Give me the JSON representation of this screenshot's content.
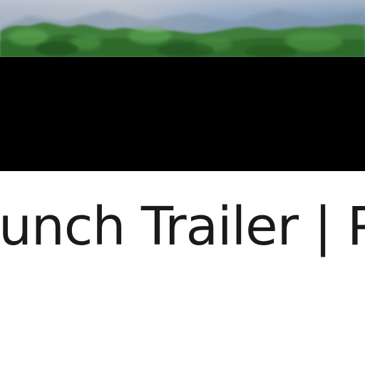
{
  "video": {
    "title_fragment": "unch Trailer | P"
  },
  "colors": {
    "background": "#ffffff",
    "letterbox": "#000000",
    "title_text": "#1a1a1a",
    "scenery_sky": "#8fa9c7",
    "scenery_foliage": "#3e8f3a"
  }
}
